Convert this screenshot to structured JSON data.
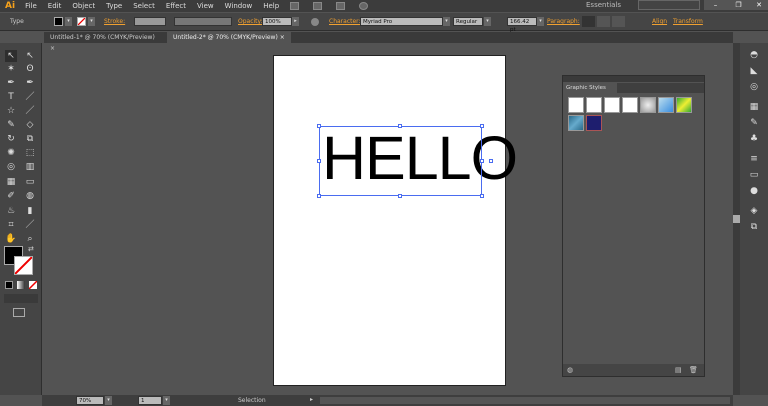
{
  "app": {
    "logo": "Ai",
    "menu": [
      "File",
      "Edit",
      "Object",
      "Type",
      "Select",
      "Effect",
      "View",
      "Window",
      "Help"
    ],
    "workspace": "Essentials",
    "window_buttons": [
      "–",
      "❐",
      "✕"
    ]
  },
  "control": {
    "mode": "Type",
    "stroke_label": "Stroke:",
    "opacity_label": "Opacity:",
    "opacity": "100%",
    "character_label": "Character:",
    "font": "Myriad Pro",
    "style": "Regular",
    "size": "166.42 pt",
    "paragraph_label": "Paragraph:",
    "align_label": "Align",
    "transform_label": "Transform"
  },
  "tabs": [
    {
      "label": "Untitled-1* @ 70% (CMYK/Preview)",
      "active": false
    },
    {
      "label": "Untitled-2* @ 70% (CMYK/Preview)",
      "active": true
    }
  ],
  "canvas": {
    "text": "HELLO"
  },
  "panel": {
    "title": "Graphic Styles"
  },
  "status": {
    "zoom": "70%",
    "page": "1",
    "tool": "Selection"
  },
  "colors": {
    "accent": "#f0a030",
    "selection": "#4a6cf0",
    "canvas": "#535353"
  }
}
